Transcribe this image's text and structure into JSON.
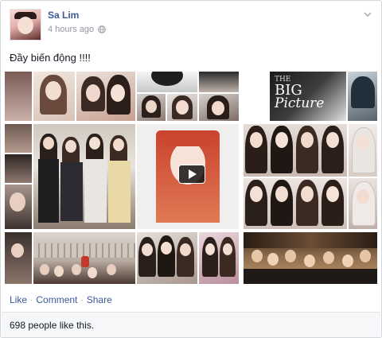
{
  "post": {
    "author": "Sa Lim",
    "time": "4 hours ago",
    "privacy_icon": "globe-icon",
    "menu_icon": "chevron-down-icon",
    "status_text": "Đầy biến động !!!!",
    "media": {
      "type": "photo-collage",
      "tile_count": 20,
      "video_tile_icon": "play-icon",
      "embedded_text": [
        "THE",
        "BIG",
        "Picture"
      ]
    },
    "actions": [
      "Like",
      "Comment",
      "Share"
    ],
    "likes_summary": "698 people like this."
  }
}
